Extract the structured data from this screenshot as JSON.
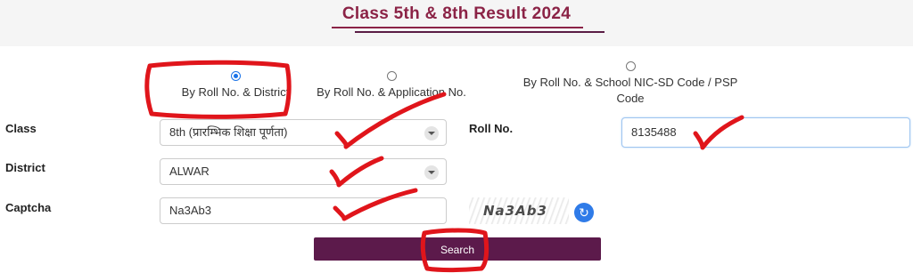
{
  "page_title": "Class 5th & 8th Result 2024",
  "search_options": [
    {
      "label": "By Roll No. & District",
      "checked": true
    },
    {
      "label": "By Roll No. & Application No.",
      "checked": false
    },
    {
      "label": "By Roll No. & School NIC-SD Code / PSP Code",
      "checked": false
    }
  ],
  "form": {
    "class_label": "Class",
    "class_value": "8th (प्रारम्भिक शिक्षा पूर्णता)",
    "district_label": "District",
    "district_value": "ALWAR",
    "captcha_label": "Captcha",
    "captcha_value": "Na3Ab3",
    "roll_label": "Roll No.",
    "roll_value": "8135488",
    "captcha_image_text": "Na3Ab3",
    "refresh_icon": "refresh-icon",
    "search_label": "Search"
  },
  "colors": {
    "title": "#8b2346",
    "button": "#5c1a4b",
    "annotation": "#e0151b"
  }
}
